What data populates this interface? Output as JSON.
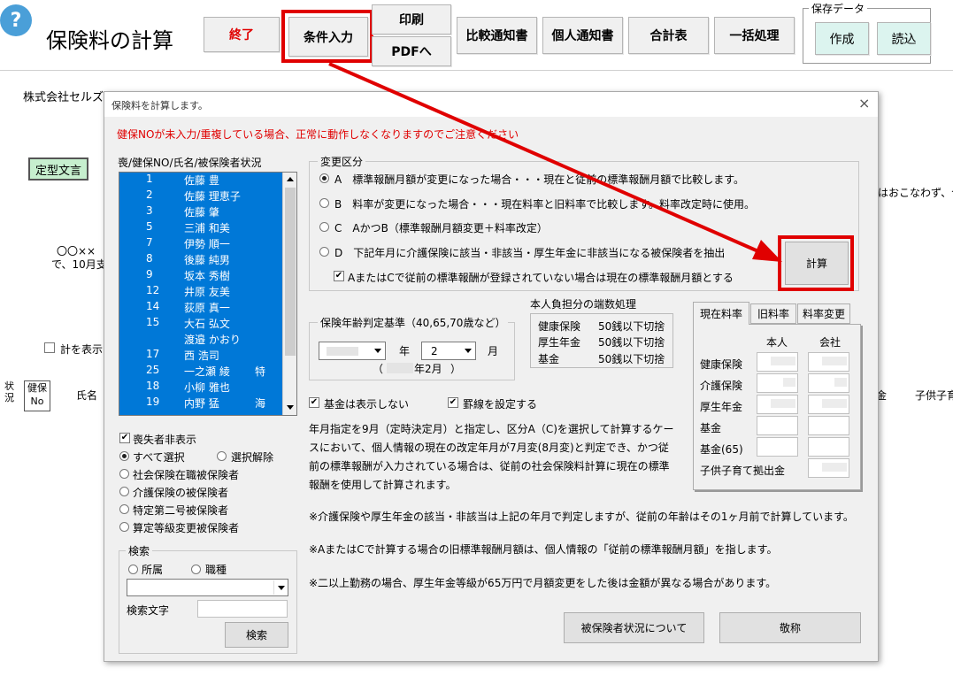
{
  "header": {
    "help_glyph": "?",
    "title": "保険料の計算",
    "buttons": {
      "exit": "終了",
      "condition": "条件入力",
      "print": "印刷",
      "pdf": "PDFへ",
      "compare": "比較通知書",
      "personal": "個人通知書",
      "total": "合計表",
      "batch": "一括処理"
    },
    "save_group": {
      "label": "保存データ",
      "create": "作成",
      "load": "読込"
    }
  },
  "background": {
    "company": "株式会社セルズ",
    "template_btn": "定型文言",
    "text1": "〇〇××",
    "text2": "で、10月支",
    "text_right": "はおこなわず、合",
    "chk_label": "計を表示し",
    "col_status": "状況",
    "col_no_1": "健保",
    "col_no_2": "No",
    "col_name": "氏名",
    "col_right1": "金",
    "col_right2": "子供子育"
  },
  "dialog": {
    "title": "保険料を計算します。",
    "close": "×",
    "warning": "健保NOが未入力/重複している場合、正常に動作しなくなりますのでご注意ください",
    "list_header": "喪/健保NO/氏名/被保険者状況",
    "list": [
      {
        "no": "1",
        "name": "佐藤 豊",
        "status": ""
      },
      {
        "no": "2",
        "name": "佐藤 理恵子",
        "status": ""
      },
      {
        "no": "3",
        "name": "佐藤 肇",
        "status": ""
      },
      {
        "no": "5",
        "name": "三浦 和美",
        "status": ""
      },
      {
        "no": "7",
        "name": "伊勢 順一",
        "status": ""
      },
      {
        "no": "8",
        "name": "後藤 純男",
        "status": ""
      },
      {
        "no": "9",
        "name": "坂本 秀樹",
        "status": ""
      },
      {
        "no": "12",
        "name": "井原 友美",
        "status": ""
      },
      {
        "no": "14",
        "name": "荻原 真一",
        "status": ""
      },
      {
        "no": "15",
        "name": "大石 弘文",
        "status": ""
      },
      {
        "no": "",
        "name": "渡邉 かおり",
        "status": ""
      },
      {
        "no": "17",
        "name": "西 浩司",
        "status": ""
      },
      {
        "no": "25",
        "name": "一之瀬 綾",
        "status": "特"
      },
      {
        "no": "18",
        "name": "小柳 雅也",
        "status": ""
      },
      {
        "no": "19",
        "name": "内野 猛",
        "status": "海"
      }
    ],
    "hide_lost": "喪失者非表示",
    "select_all": "すべて選択",
    "deselect": "選択解除",
    "filters": [
      "社会保険在職被保険者",
      "介護保険の被保険者",
      "特定第二号被保険者",
      "算定等級変更被保険者"
    ],
    "search": {
      "label": "検索",
      "dept": "所属",
      "job": "職種",
      "text_label": "検索文字",
      "button": "検索"
    },
    "change": {
      "label": "変更区分",
      "a": "A　標準報酬月額が変更になった場合・・・現在と従前の標準報酬月額で比較します。",
      "b": "B　料率が変更になった場合・・・現在料率と旧料率で比較します。料率改定時に使用。",
      "c": "C　AかつB（標準報酬月額変更＋料率改定）",
      "d": "D　下記年月に介護保険に該当・非該当・厚生年金に非該当になる被保険者を抽出",
      "note": "AまたはCで従前の標準報酬が登録されていない場合は現在の標準報酬月額とする"
    },
    "calc": "計算",
    "age": {
      "label": "保険年齢判定基準（40,65,70歳など）",
      "year_unit": "年",
      "month_value": "2",
      "month_unit": "月",
      "sub_open": "（",
      "sub_value": "年2月",
      "sub_close": "）"
    },
    "rounding": {
      "label": "本人負担分の端数処理",
      "rows": [
        {
          "name": "健康保険",
          "value": "50銭以下切捨"
        },
        {
          "name": "厚生年金",
          "value": "50銭以下切捨"
        },
        {
          "name": "基金",
          "value": "50銭以下切捨"
        }
      ]
    },
    "rates": {
      "tabs": [
        "現在料率",
        "旧料率",
        "料率変更"
      ],
      "col_person": "本人",
      "col_company": "会社",
      "rows": [
        "健康保険",
        "介護保険",
        "厚生年金",
        "基金",
        "基金(65)"
      ],
      "child": "子供子育て拠出金"
    },
    "opt_hide_fund": "基金は表示しない",
    "opt_lines": "罫線を設定する",
    "explain": [
      "年月指定を9月（定時決定月）と指定し、区分A（C)を選択して計算するケー",
      "スにおいて、個人情報の現在の改定年月が7月変(8月変)と判定でき、かつ従",
      "前の標準報酬が入力されている場合は、従前の社会保険料計算に現在の標準",
      "報酬を使用して計算されます。"
    ],
    "note1": "※介護保険や厚生年金の該当・非該当は上記の年月で判定しますが、従前の年齢はその1ヶ月前で計算しています。",
    "note2": "※AまたはCで計算する場合の旧標準報酬月額は、個人情報の「従前の標準報酬月額」を指します。",
    "note3": "※二以上勤務の場合、厚生年金等級が65万円で月額変更をした後は金額が異なる場合があります。",
    "status_btn": "被保険者状況について",
    "close_btn": "敬称"
  },
  "colors": {
    "highlight": "#e00000",
    "selection": "#0078d7",
    "warning": "#e00000",
    "save_btn": "#dcf4ef",
    "template_btn": "#c6efce"
  }
}
